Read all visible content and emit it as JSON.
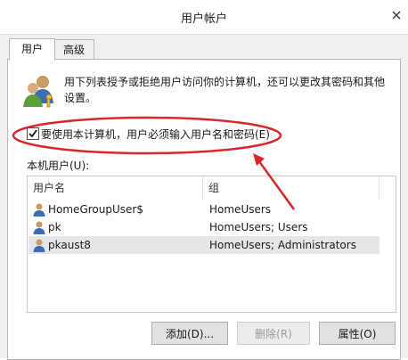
{
  "window": {
    "title": "用户帐户"
  },
  "tabs": [
    {
      "label": "用户",
      "active": true
    },
    {
      "label": "高级",
      "active": false
    }
  ],
  "description": "用下列表授予或拒绝用户访问你的计算机，还可以更改其密码和其他设置。",
  "require_login": {
    "checked": true,
    "label": "要使用本计算机，用户必须输入用户名和密码(E)"
  },
  "local_users_label": "本机用户(U):",
  "table": {
    "columns": [
      "用户名",
      "组"
    ],
    "rows": [
      {
        "name": "HomeGroupUser$",
        "groups": "HomeUsers",
        "selected": false
      },
      {
        "name": "pk",
        "groups": "HomeUsers; Users",
        "selected": false
      },
      {
        "name": "pkaust8",
        "groups": "HomeUsers; Administrators",
        "selected": true
      }
    ]
  },
  "buttons": {
    "add": "添加(D)...",
    "remove": "删除(R)",
    "properties": "属性(O)"
  },
  "annotation": {
    "color": "#d9262c"
  },
  "icons": {
    "close": "close-icon",
    "users": "users-icon",
    "user_row": "user-icon",
    "check": "checkmark-icon"
  }
}
